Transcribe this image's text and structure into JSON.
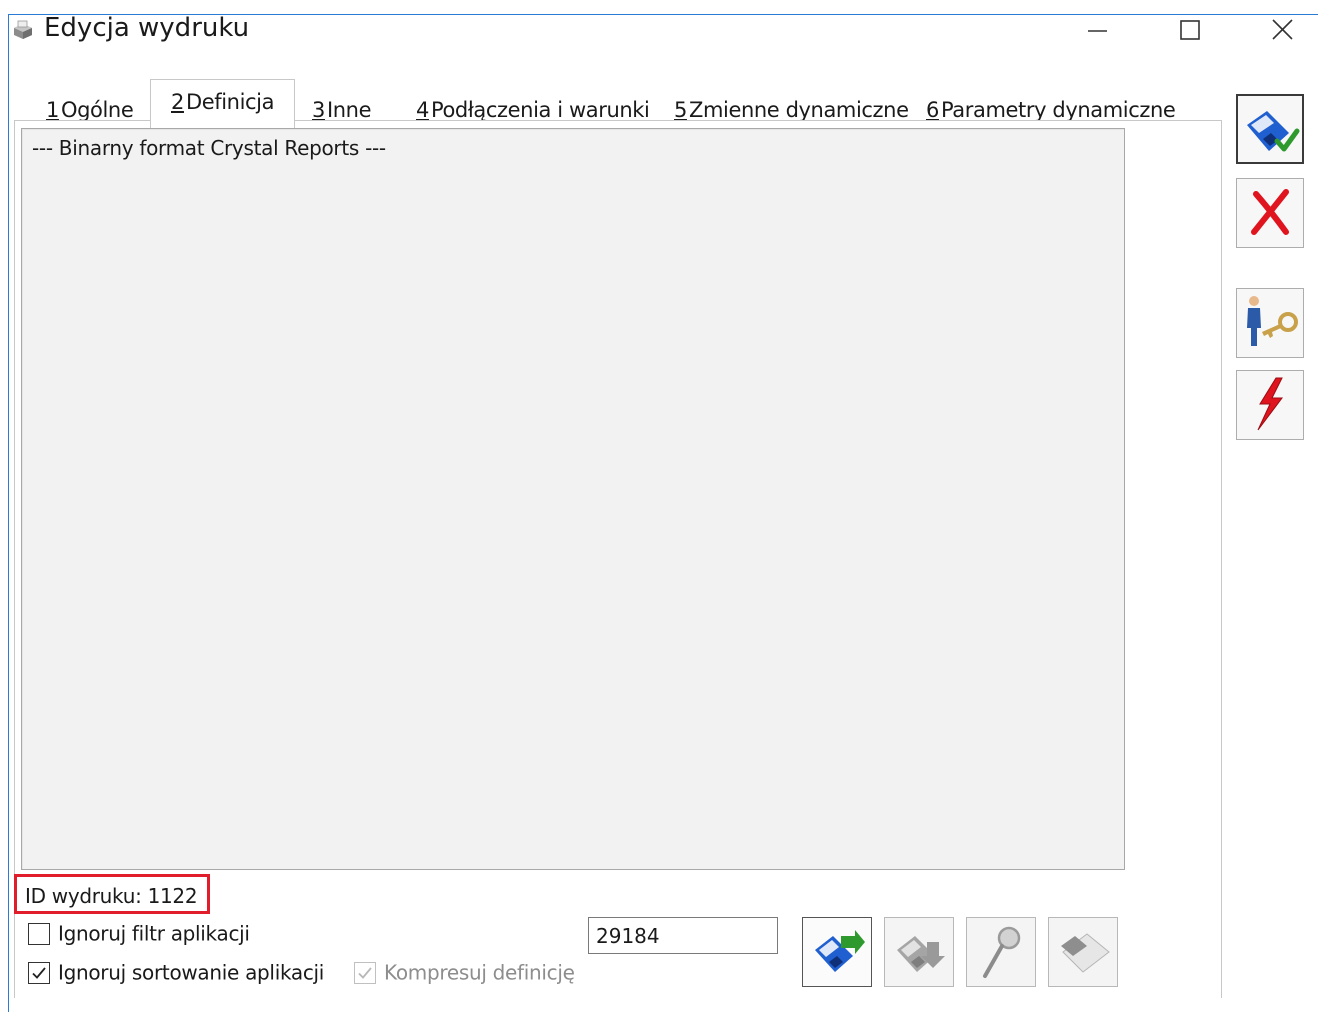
{
  "window": {
    "title": "Edycja wydruku",
    "icon": "printer-app-icon",
    "controls": [
      "minimize-icon",
      "maximize-icon",
      "close-icon"
    ]
  },
  "tabs": [
    {
      "num": "1",
      "label": "Ogólne",
      "active": false
    },
    {
      "num": "2",
      "label": "Definicja",
      "active": true
    },
    {
      "num": "3",
      "label": "Inne",
      "active": false
    },
    {
      "num": "4",
      "label": "Podłączenia i warunki",
      "active": false
    },
    {
      "num": "5",
      "label": "Zmienne dynamiczne",
      "active": false
    },
    {
      "num": "6",
      "label": "Parametry dynamiczne",
      "active": false
    }
  ],
  "definition": {
    "text": "--- Binarny format Crystal Reports ---"
  },
  "print_id": {
    "label": "ID wydruku: 1122"
  },
  "options": {
    "ignore_filter": {
      "label": "Ignoruj filtr aplikacji",
      "checked": false
    },
    "ignore_sort": {
      "label": "Ignoruj sortowanie aplikacji",
      "checked": true
    },
    "compress": {
      "label": "Kompresuj definicję",
      "checked": true,
      "disabled": true
    }
  },
  "size_field": {
    "value": "29184"
  },
  "toolbar": {
    "buttons": [
      {
        "icon": "import-disk-icon",
        "enabled": true
      },
      {
        "icon": "export-disk-icon",
        "enabled": false
      },
      {
        "icon": "magnifier-icon",
        "enabled": false
      },
      {
        "icon": "eraser-icon",
        "enabled": false
      }
    ]
  },
  "side_buttons": [
    {
      "icon": "save-confirm-icon",
      "primary": true
    },
    {
      "icon": "cancel-x-icon",
      "primary": false
    },
    {
      "icon": "permissions-key-icon",
      "primary": false
    },
    {
      "icon": "lightning-icon",
      "primary": false
    }
  ],
  "colors": {
    "window_border": "#2b7bd4",
    "highlight": "#e21d2b",
    "disk_blue": "#1f5fd0",
    "check_green": "#2e9a2e",
    "cancel_red": "#e0141e"
  }
}
